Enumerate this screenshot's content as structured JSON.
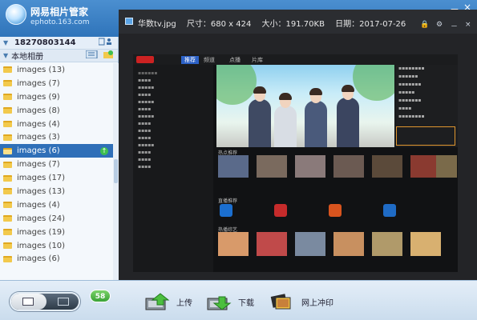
{
  "app": {
    "title": "网易相片管家",
    "subtitle": "ephoto.163.com"
  },
  "window_controls": {
    "minimize": "－",
    "close": "×"
  },
  "sidebar": {
    "account": "18270803144",
    "section_title": "本地相册",
    "albums": [
      {
        "label": "images (13)"
      },
      {
        "label": "images (7)"
      },
      {
        "label": "images (9)"
      },
      {
        "label": "images (8)"
      },
      {
        "label": "images (4)"
      },
      {
        "label": "images (3)"
      },
      {
        "label": "images (6)",
        "selected": true
      },
      {
        "label": "images (7)"
      },
      {
        "label": "images (17)"
      },
      {
        "label": "images (13)"
      },
      {
        "label": "images (4)"
      },
      {
        "label": "images (24)"
      },
      {
        "label": "images (19)"
      },
      {
        "label": "images (10)"
      },
      {
        "label": "images (6)"
      }
    ]
  },
  "viewer": {
    "filename": "华数tv.jpg",
    "size": "尺寸：680 x 424",
    "filesize": "大小：191.70KB",
    "date": "日期：2017-07-26",
    "embedded": {
      "tabs": [
        "推荐",
        "频道",
        "点播",
        "片库"
      ],
      "hot_label": "热点推荐",
      "live_label": "直播推荐",
      "variety_label": "热播综艺"
    }
  },
  "bottom": {
    "badge_count": "58",
    "upload": "上传",
    "download": "下载",
    "print": "网上冲印"
  }
}
